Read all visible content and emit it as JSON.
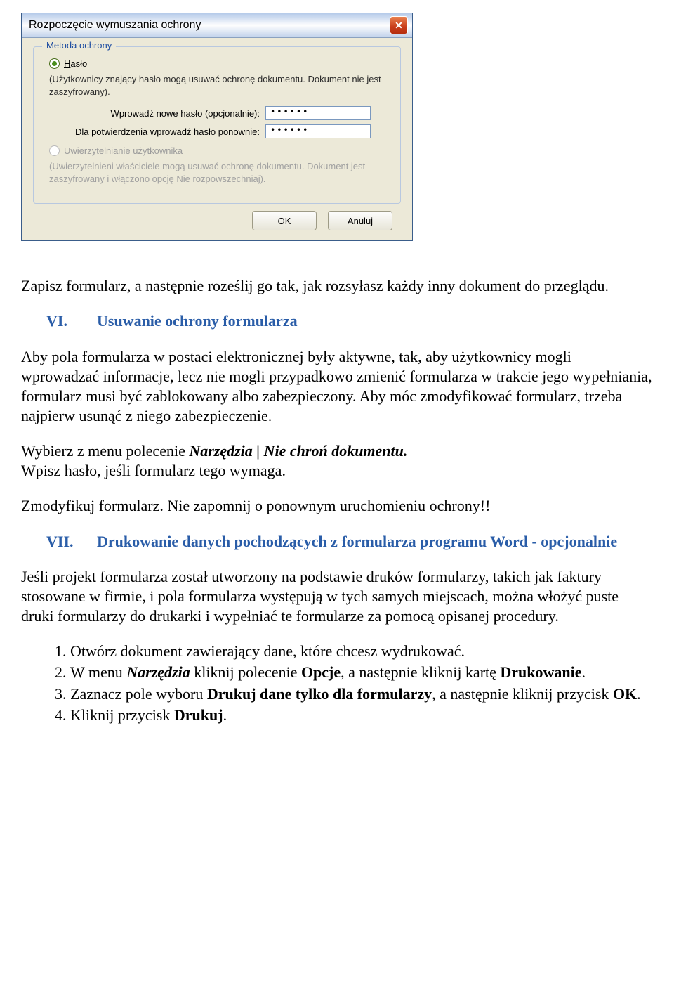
{
  "dialog": {
    "title": "Rozpoczęcie wymuszania ochrony",
    "group_title": "Metoda ochrony",
    "radio_password_prefix": "H",
    "radio_password_rest": "asło",
    "password_desc": "(Użytkownicy znający hasło mogą usuwać ochronę dokumentu. Dokument nie jest zaszyfrowany).",
    "new_pw_label": "Wprowadź nowe hasło (opcjonalnie):",
    "confirm_pw_label": "Dla potwierdzenia wprowadź hasło ponownie:",
    "pw_value": "••••••",
    "radio_user_label": "Uwierzytelnianie użytkownika",
    "user_desc": "(Uwierzytelnieni właściciele mogą usuwać ochronę dokumentu. Dokument jest zaszyfrowany i włączono opcję Nie rozpowszechniaj).",
    "ok": "OK",
    "cancel": "Anuluj"
  },
  "body": {
    "p1": "Zapisz formularz, a następnie roześlij go tak, jak rozsyłasz każdy inny dokument do przeglądu.",
    "h6_num": "VI.",
    "h6_txt": "Usuwanie ochrony formularza",
    "p2": "Aby pola formularza w postaci elektronicznej były aktywne, tak, aby użytkownicy mogli wprowadzać informacje, lecz nie mogli przypadkowo zmienić formularza w trakcie jego wypełniania, formularz musi być zablokowany albo zabezpieczony. Aby móc zmodyfikować formularz, trzeba najpierw usunąć z niego zabezpieczenie.",
    "p3a": "Wybierz z menu polecenie ",
    "p3i": "Narzędzia | Nie chroń dokumentu.",
    "p4": "Wpisz hasło, jeśli formularz tego wymaga.",
    "p5": "Zmodyfikuj formularz. Nie zapomnij o ponownym uruchomieniu ochrony!!",
    "h7_num": "VII.",
    "h7_txt": "Drukowanie danych pochodzących z formularza programu Word - opcjonalnie",
    "p6": "Jeśli projekt formularza został utworzony na podstawie druków formularzy, takich jak faktury stosowane w firmie, i pola formularza występują w tych samych miejscach, można włożyć puste druki formularzy do drukarki i wypełniać te formularze za pomocą opisanej procedury.",
    "s1": "Otwórz dokument zawierający dane, które chcesz wydrukować.",
    "s2a": "W menu ",
    "s2i": "Narzędzia",
    "s2b": " kliknij polecenie ",
    "s2c": "Opcje",
    "s2d": ", a następnie kliknij kartę ",
    "s2e": "Drukowanie",
    "s2f": ".",
    "s3a": "Zaznacz pole wyboru ",
    "s3b": "Drukuj dane tylko dla formularzy",
    "s3c": ", a następnie kliknij przycisk ",
    "s3d": "OK",
    "s3e": ".",
    "s4a": "Kliknij przycisk ",
    "s4b": "Drukuj",
    "s4c": "."
  }
}
